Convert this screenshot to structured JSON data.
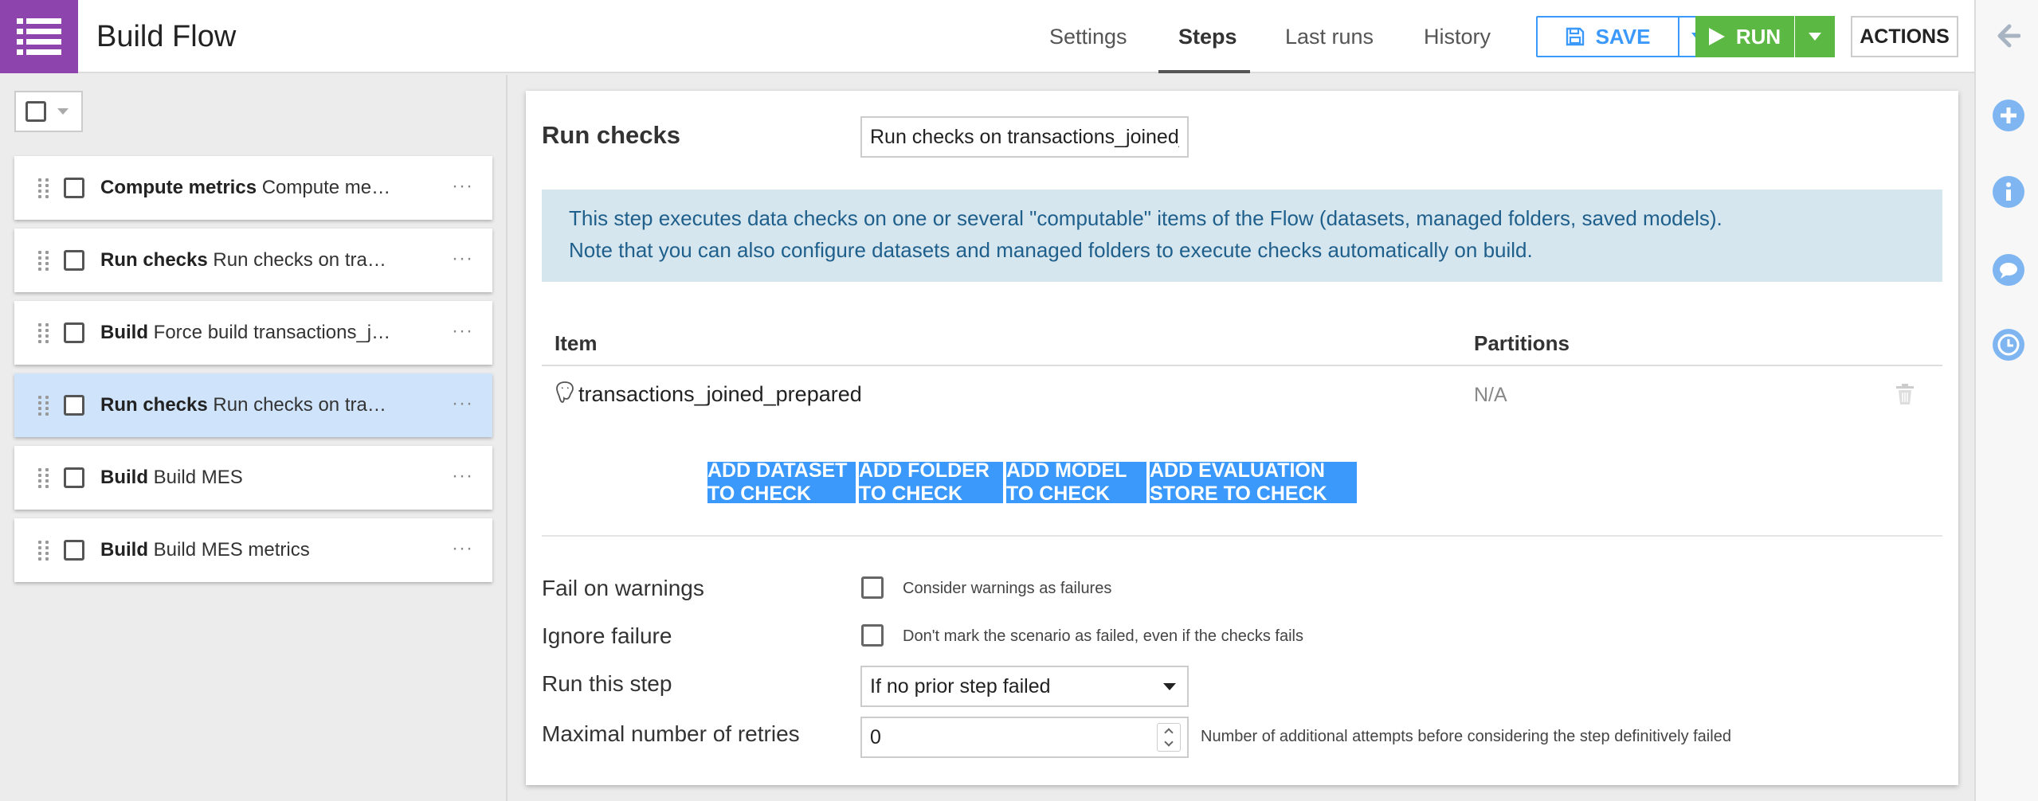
{
  "header": {
    "title": "Build Flow",
    "tabs": [
      {
        "label": "Settings",
        "active": false
      },
      {
        "label": "Steps",
        "active": true
      },
      {
        "label": "Last runs",
        "active": false
      },
      {
        "label": "History",
        "active": false
      }
    ],
    "save_label": "SAVE",
    "run_label": "RUN",
    "actions_label": "ACTIONS"
  },
  "colors": {
    "app_icon_bg": "#8e44ad",
    "primary_blue": "#3b99fc",
    "run_green": "#5bb843",
    "info_bg": "#d6e6ef",
    "info_text": "#1f5f8b",
    "selected_row": "#cfe4fb"
  },
  "steps": [
    {
      "type": "Compute metrics",
      "name": "Compute metrics on transactions_joined_prepared",
      "selected": false
    },
    {
      "type": "Run checks",
      "name": "Run checks on transactions_joined_prepared",
      "selected": false
    },
    {
      "type": "Build",
      "name": "Force build transactions_joined_prepared",
      "selected": false
    },
    {
      "type": "Run checks",
      "name": "Run checks on transactions_joined_prepared",
      "selected": true
    },
    {
      "type": "Build",
      "name": "Build MES",
      "selected": false
    },
    {
      "type": "Build",
      "name": "Build MES metrics",
      "selected": false
    }
  ],
  "step_detail": {
    "title": "Run checks",
    "name_value": "Run checks on transactions_joined_",
    "info_line1": "This step executes data checks on one or several \"computable\" items of the Flow (datasets, managed folders, saved models).",
    "info_line2": "Note that you can also configure datasets and managed folders to execute checks automatically on build.",
    "table": {
      "col_item": "Item",
      "col_partitions": "Partitions",
      "rows": [
        {
          "item": "transactions_joined_prepared",
          "partitions": "N/A",
          "icon": "postgresql-icon"
        }
      ]
    },
    "add_buttons": [
      "ADD DATASET TO CHECK",
      "ADD FOLDER TO CHECK",
      "ADD MODEL TO CHECK",
      "ADD EVALUATION STORE TO CHECK"
    ],
    "fail_on_warnings": {
      "label": "Fail on warnings",
      "desc": "Consider warnings as failures",
      "checked": false
    },
    "ignore_failure": {
      "label": "Ignore failure",
      "desc": "Don't mark the scenario as failed, even if the checks fails",
      "checked": false
    },
    "run_this_step": {
      "label": "Run this step",
      "value": "If no prior step failed"
    },
    "max_retries": {
      "label": "Maximal number of retries",
      "value": "0",
      "desc": "Number of additional attempts before considering the step definitively failed"
    }
  },
  "right_rail": [
    "back-arrow-icon",
    "add-icon",
    "info-icon",
    "chat-icon",
    "clock-icon"
  ]
}
